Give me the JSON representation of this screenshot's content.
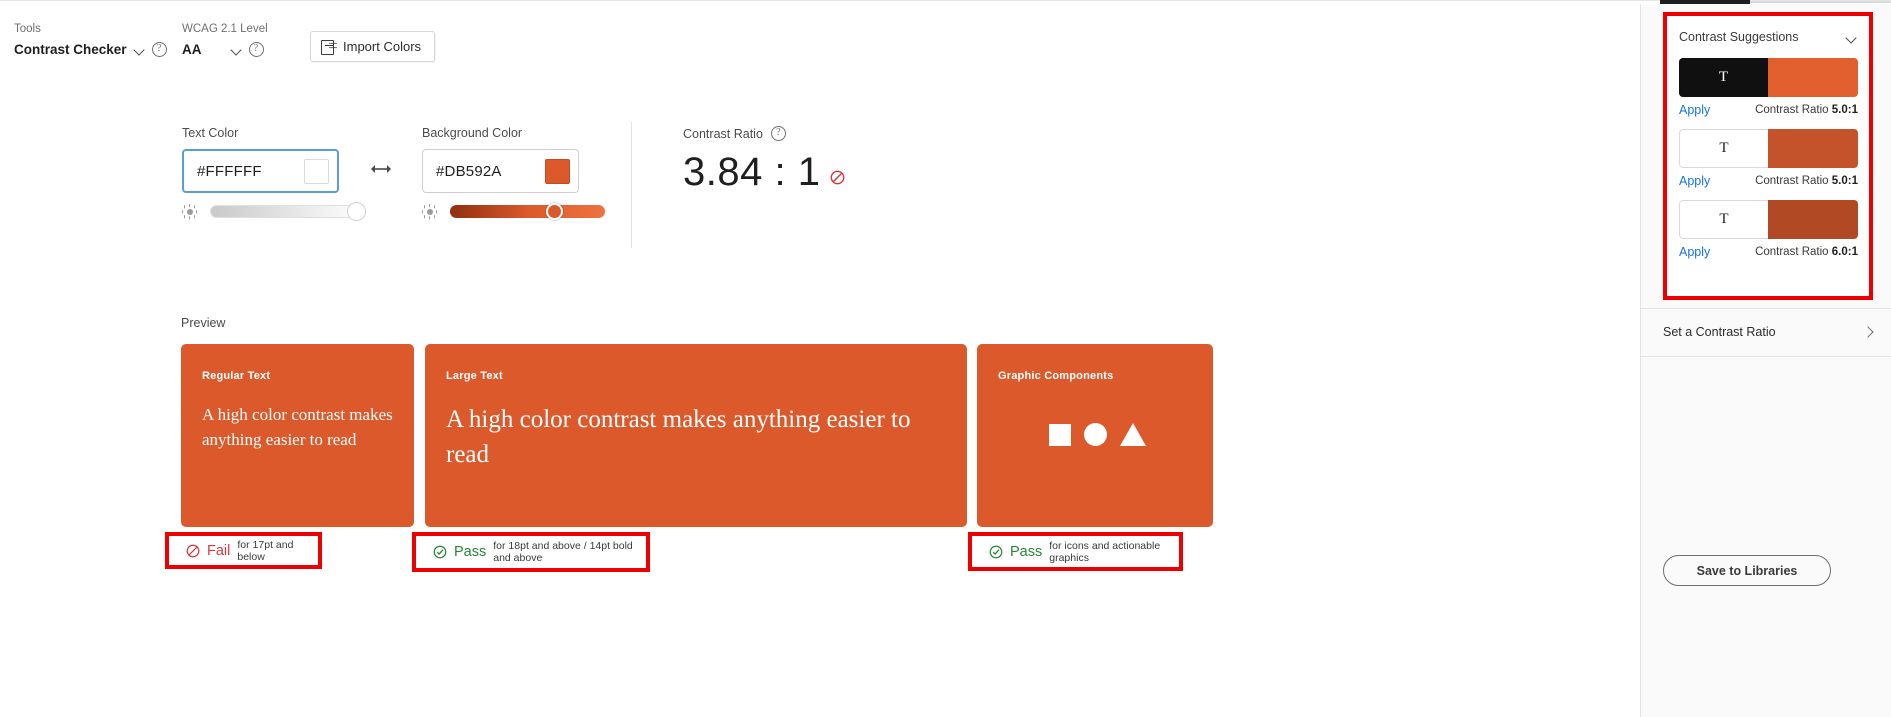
{
  "toolbar": {
    "tools_label": "Tools",
    "tools_value": "Contrast Checker",
    "level_label": "WCAG 2.1 Level",
    "level_value": "AA",
    "import_button": "Import Colors"
  },
  "colors": {
    "text": {
      "label": "Text Color",
      "hex": "#FFFFFF",
      "swatch": "#FFFFFF",
      "slider_percent": 100
    },
    "background": {
      "label": "Background Color",
      "hex": "#DB592A",
      "swatch": "#DB592A",
      "slider_percent": 68
    }
  },
  "ratio": {
    "label": "Contrast Ratio",
    "value": "3.84 : 1",
    "status": "fail"
  },
  "preview": {
    "label": "Preview",
    "cards": [
      {
        "kicker": "Regular Text",
        "body": "A high color contrast makes anything easier to read",
        "type": "text"
      },
      {
        "kicker": "Large Text",
        "body": "A high color contrast makes anything easier to read",
        "type": "text"
      },
      {
        "kicker": "Graphic Components",
        "body": "",
        "type": "shapes"
      }
    ],
    "results": [
      {
        "status": "Fail",
        "state": "fail",
        "note": "for 17pt and below"
      },
      {
        "status": "Pass",
        "state": "pass",
        "note": "for 18pt and above / 14pt bold and above"
      },
      {
        "status": "Pass",
        "state": "pass",
        "note": "for icons and actionable graphics"
      }
    ]
  },
  "sidebar": {
    "suggestions_title": "Contrast Suggestions",
    "suggestions": [
      {
        "apply_label": "Apply",
        "ratio_label": "Contrast Ratio",
        "ratio_value": "5.0:1",
        "fg": "#101010",
        "bg": "#E2602F",
        "glyph": "T",
        "glyph_color": "#FFFFFF",
        "bordered": false
      },
      {
        "apply_label": "Apply",
        "ratio_label": "Contrast Ratio",
        "ratio_value": "5.0:1",
        "fg": "#FFFFFF",
        "bg": "#C4522A",
        "glyph": "T",
        "glyph_color": "#1F1F1F",
        "bordered": true
      },
      {
        "apply_label": "Apply",
        "ratio_label": "Contrast Ratio",
        "ratio_value": "6.0:1",
        "fg": "#FFFFFF",
        "bg": "#B14A24",
        "glyph": "T",
        "glyph_color": "#1F1F1F",
        "bordered": true
      }
    ],
    "set_ratio_label": "Set a Contrast Ratio",
    "save_button": "Save to Libraries"
  },
  "accent": {
    "orange": "#DB592A",
    "highlight_red": "#EE0000",
    "link_blue": "#1473E6",
    "pass_green": "#2A8438",
    "fail_red": "#D7373F"
  }
}
